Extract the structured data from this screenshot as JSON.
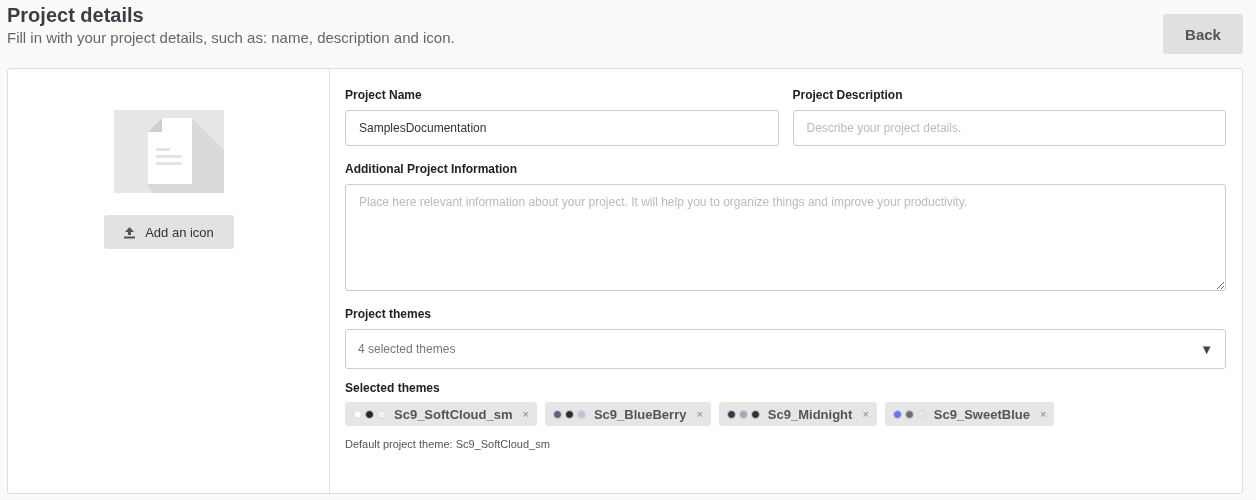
{
  "header": {
    "title": "Project details",
    "subtitle": "Fill in with your project details, such as: name, description and icon.",
    "back_button": "Back"
  },
  "icon_panel": {
    "add_button": "Add an icon"
  },
  "form": {
    "name": {
      "label": "Project Name",
      "value": "SamplesDocumentation"
    },
    "description": {
      "label": "Project Description",
      "placeholder": "Describe your project details."
    },
    "additional": {
      "label": "Additional Project Information",
      "placeholder": "Place here relevant information about your project. It will help you to organize things and improve your productivity."
    },
    "themes": {
      "label": "Project themes",
      "value": "4 selected themes",
      "arrow": "▼"
    },
    "selected_themes": {
      "label": "Selected themes",
      "items": [
        {
          "name": "Sc9_SoftCloud_sm",
          "remove": "×",
          "swatches": [
            {
              "color": "#ffffff"
            },
            {
              "color": "#222630"
            },
            {
              "color": "#f2f3f5"
            }
          ]
        },
        {
          "name": "Sc9_BlueBerry",
          "remove": "×",
          "swatches": [
            {
              "color": "#5c6280"
            },
            {
              "color": "#272b35"
            },
            {
              "color": "#c0c4d8"
            }
          ]
        },
        {
          "name": "Sc9_Midnight",
          "remove": "×",
          "swatches": [
            {
              "color": "#333c4c"
            },
            {
              "color": "#a0aab8"
            },
            {
              "color": "#2c323c"
            }
          ]
        },
        {
          "name": "Sc9_SweetBlue",
          "remove": "×",
          "swatches": [
            {
              "color": "#6a72f0"
            },
            {
              "color": "#6c7078"
            },
            {
              "color": "#e6eaf0"
            }
          ]
        }
      ]
    },
    "default_theme": "Default project theme: Sc9_SoftCloud_sm"
  }
}
